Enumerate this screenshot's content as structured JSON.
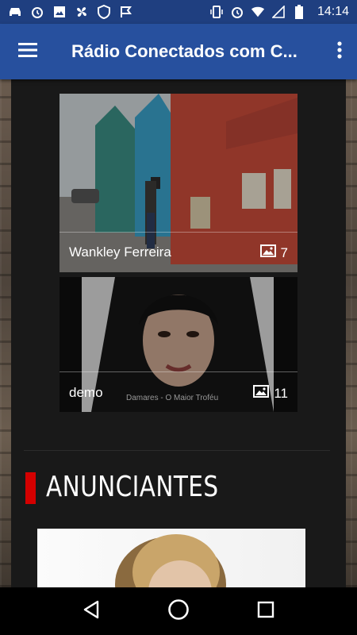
{
  "status_bar": {
    "time": "14:14",
    "left_icons": [
      "car-icon",
      "alarm-icon",
      "image-icon",
      "fan-icon",
      "shield-icon",
      "check-flag-icon"
    ],
    "right_icons": [
      "vibrate-icon",
      "alarm-icon",
      "wifi-icon",
      "signal-off-icon",
      "battery-icon"
    ]
  },
  "app_bar": {
    "title": "Rádio Conectados com C...",
    "menu_icon": "hamburger-icon",
    "more_icon": "more-vert-icon"
  },
  "gallery": [
    {
      "caption": "Wankley Ferreira",
      "count": "7",
      "subtitle": ""
    },
    {
      "caption": "demo",
      "count": "11",
      "subtitle": "Damares - O Maior Troféu"
    }
  ],
  "section": {
    "title": "ANUNCIANTES"
  },
  "nav": {
    "back_icon": "back-icon",
    "home_icon": "home-icon",
    "recents_icon": "recents-icon"
  },
  "colors": {
    "app_bar": "#27509e",
    "status_bar": "#1f3f80",
    "accent": "#d40000",
    "panel": "#191919"
  }
}
